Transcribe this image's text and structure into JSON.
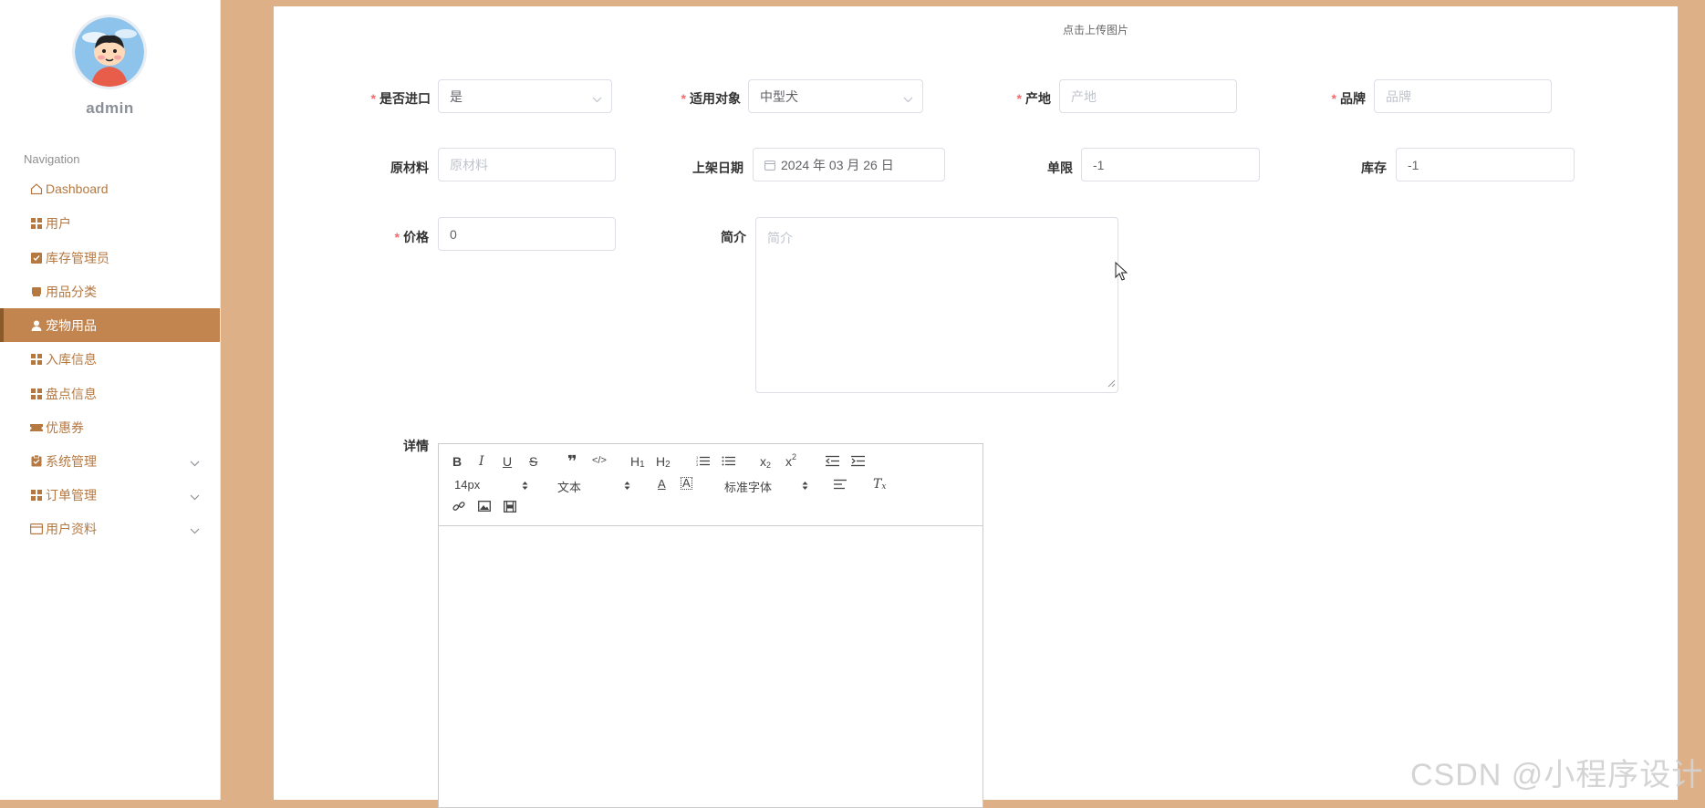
{
  "sidebar": {
    "username": "admin",
    "nav_title": "Navigation",
    "items": [
      {
        "label": "Dashboard",
        "icon": "home-icon"
      },
      {
        "label": "用户",
        "icon": "grid-icon"
      },
      {
        "label": "库存管理员",
        "icon": "check-square-icon"
      },
      {
        "label": "用品分类",
        "icon": "box-icon"
      },
      {
        "label": "宠物用品",
        "icon": "person-icon",
        "active": true
      },
      {
        "label": "入库信息",
        "icon": "grid-icon"
      },
      {
        "label": "盘点信息",
        "icon": "grid-icon"
      },
      {
        "label": "优惠券",
        "icon": "ticket-icon"
      },
      {
        "label": "系统管理",
        "icon": "clipboard-icon",
        "expandable": true
      },
      {
        "label": "订单管理",
        "icon": "grid-icon",
        "expandable": true
      },
      {
        "label": "用户资料",
        "icon": "card-icon",
        "expandable": true
      }
    ]
  },
  "form": {
    "upload_hint": "点击上传图片",
    "is_import": {
      "label": "是否进口",
      "value": "是"
    },
    "target": {
      "label": "适用对象",
      "value": "中型犬"
    },
    "origin": {
      "label": "产地",
      "placeholder": "产地"
    },
    "brand": {
      "label": "品牌",
      "placeholder": "品牌"
    },
    "material": {
      "label": "原材料",
      "placeholder": "原材料"
    },
    "shelf_date": {
      "label": "上架日期",
      "value": "2024 年 03 月 26 日"
    },
    "limit": {
      "label": "单限",
      "value": "-1"
    },
    "stock": {
      "label": "库存",
      "value": "-1"
    },
    "price": {
      "label": "价格",
      "value": "0"
    },
    "intro": {
      "label": "简介",
      "placeholder": "简介"
    },
    "detail": {
      "label": "详情"
    }
  },
  "editor": {
    "font_size": "14px",
    "text_type": "文本",
    "font_family": "标准字体"
  },
  "watermark": "CSDN @小程序设计",
  "colors": {
    "accent": "#c28550",
    "background": "#deb087",
    "nav_text": "#b57841",
    "required": "#f56c6c"
  }
}
